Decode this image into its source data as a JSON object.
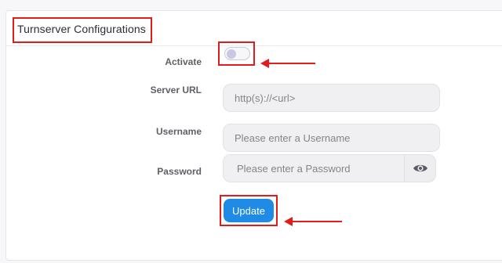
{
  "header": {
    "title": "Turnserver Configurations"
  },
  "form": {
    "activate_label": "Activate",
    "activate_state": "off",
    "server_url_label": "Server URL",
    "server_url_placeholder": "http(s)://<url>",
    "username_label": "Username",
    "username_placeholder": "Please enter a Username",
    "password_label": "Password",
    "password_placeholder": "Please enter a Password",
    "update_label": "Update"
  },
  "colors": {
    "accent": "#1f8be6",
    "highlight": "#e41b1b"
  },
  "icons": {
    "password_toggle": "eye-icon",
    "annotation_arrow": "arrow-left-icon"
  }
}
